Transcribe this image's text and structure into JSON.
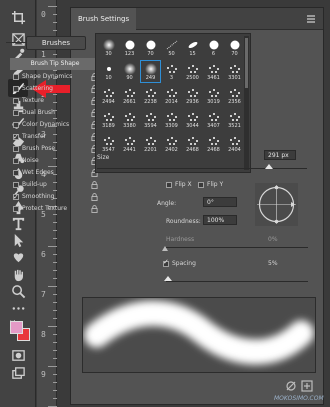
{
  "panel": {
    "title": "Brush Settings",
    "brushes_button": "Brushes",
    "tip_shape_label": "Brush Tip Shape"
  },
  "options": [
    {
      "label": "Shape Dynamics",
      "checked": false
    },
    {
      "label": "Scattering",
      "checked": false
    },
    {
      "label": "Texture",
      "checked": false
    },
    {
      "label": "Dual Brush",
      "checked": false
    },
    {
      "label": "Color Dynamics",
      "checked": false
    },
    {
      "label": "Transfer",
      "checked": true
    },
    {
      "label": "Brush Pose",
      "checked": false
    },
    {
      "label": "Noise",
      "checked": false
    },
    {
      "label": "Wet Edges",
      "checked": false
    },
    {
      "label": "Build-up",
      "checked": false
    },
    {
      "label": "Smoothing",
      "checked": true
    },
    {
      "label": "Protect Texture",
      "checked": false
    }
  ],
  "presets": [
    {
      "size": "30",
      "kind": "dot-soft"
    },
    {
      "size": "123",
      "kind": "dot-hard"
    },
    {
      "size": "70",
      "kind": "dot-hard"
    },
    {
      "size": "50",
      "kind": "stroke"
    },
    {
      "size": "15",
      "kind": "leaf"
    },
    {
      "size": "6",
      "kind": "dot-hard"
    },
    {
      "size": "70",
      "kind": "dot-hard"
    },
    {
      "size": "10",
      "kind": "dot-small"
    },
    {
      "size": "90",
      "kind": "dot-soft"
    },
    {
      "size": "249",
      "kind": "dot-soft",
      "selected": true
    },
    {
      "size": "3",
      "kind": "texture"
    },
    {
      "size": "2500",
      "kind": "texture"
    },
    {
      "size": "3461",
      "kind": "texture"
    },
    {
      "size": "3301",
      "kind": "texture"
    },
    {
      "size": "2494",
      "kind": "texture"
    },
    {
      "size": "2661",
      "kind": "texture"
    },
    {
      "size": "2238",
      "kind": "texture"
    },
    {
      "size": "2014",
      "kind": "texture"
    },
    {
      "size": "2936",
      "kind": "texture"
    },
    {
      "size": "3019",
      "kind": "texture"
    },
    {
      "size": "2356",
      "kind": "texture"
    },
    {
      "size": "3189",
      "kind": "texture"
    },
    {
      "size": "3380",
      "kind": "texture"
    },
    {
      "size": "3594",
      "kind": "texture"
    },
    {
      "size": "3309",
      "kind": "texture"
    },
    {
      "size": "3044",
      "kind": "texture"
    },
    {
      "size": "3407",
      "kind": "texture"
    },
    {
      "size": "3521",
      "kind": "texture"
    },
    {
      "size": "3547",
      "kind": "texture"
    },
    {
      "size": "2441",
      "kind": "texture"
    },
    {
      "size": "2201",
      "kind": "texture"
    },
    {
      "size": "2402",
      "kind": "texture"
    },
    {
      "size": "2468",
      "kind": "texture"
    },
    {
      "size": "2468",
      "kind": "texture"
    },
    {
      "size": "2404",
      "kind": "texture"
    }
  ],
  "size": {
    "label": "Size",
    "value": "291 px",
    "level": 0.8
  },
  "flip": {
    "x_label": "Flip X",
    "y_label": "Flip Y"
  },
  "angle": {
    "label": "Angle:",
    "value": "0°"
  },
  "roundness": {
    "label": "Roundness:",
    "value": "100%"
  },
  "hardness": {
    "label": "Hardness",
    "value": "0%"
  },
  "spacing": {
    "label": "Spacing",
    "value": "5%",
    "checked": true
  },
  "ruler": {
    "numbers": [
      "0",
      "1",
      "2",
      "3",
      "4",
      "5",
      "6",
      "7",
      "8",
      "9"
    ]
  },
  "colors": {
    "foreground": "#e49ac6",
    "background": "#e8353b",
    "arrow": "#e8202a",
    "selection": "#2f8fd6"
  },
  "watermark": "MOKOSIMO.COM"
}
